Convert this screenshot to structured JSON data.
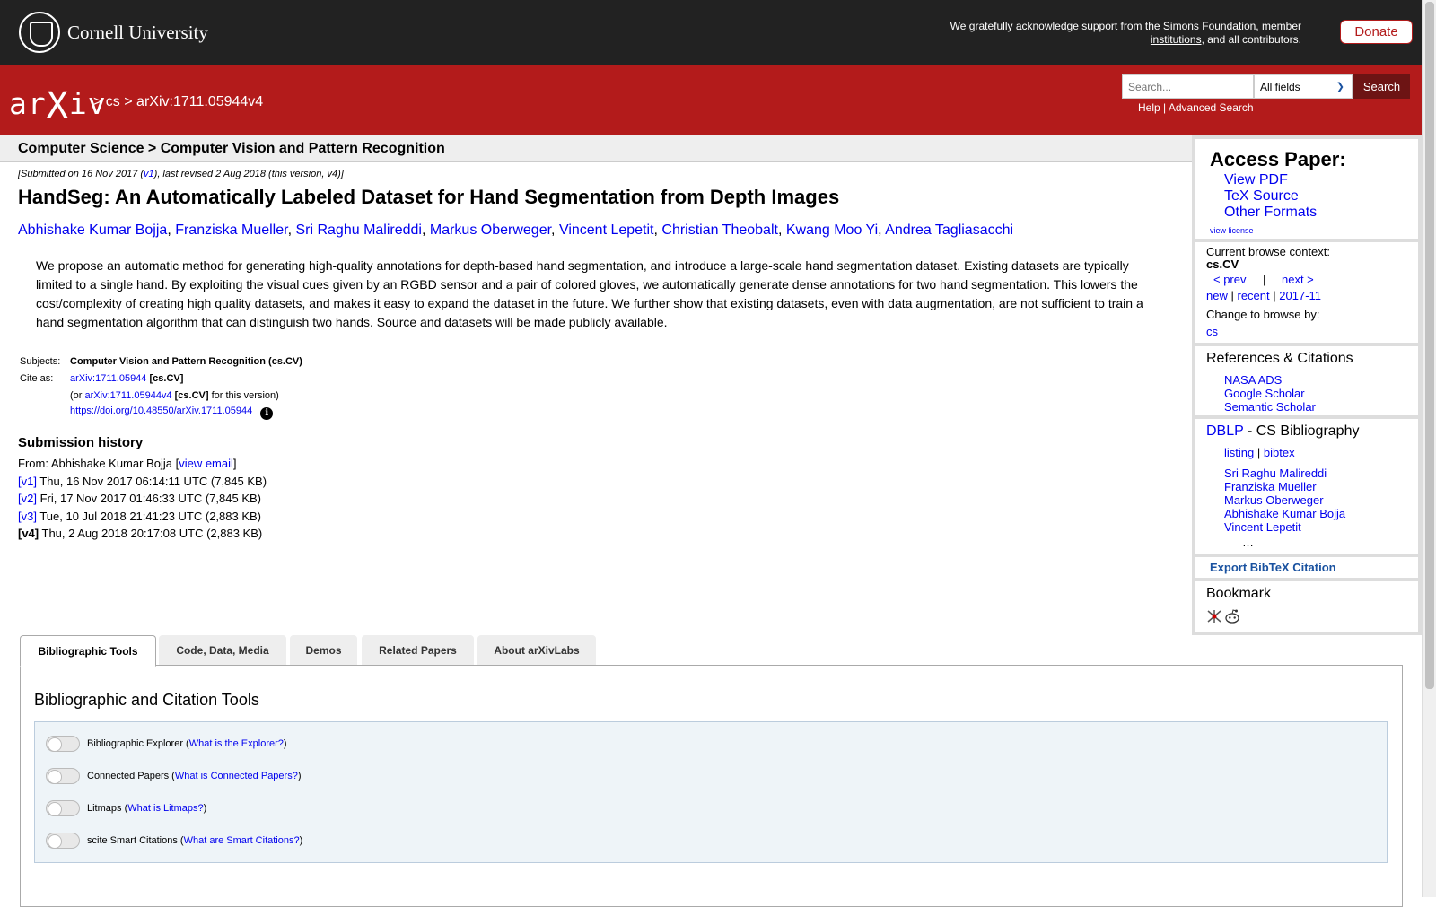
{
  "header": {
    "university": "Cornell University",
    "support_pre": "We gratefully acknowledge support from the Simons Foundation,",
    "support_link": "member institutions",
    "support_post": ", and all contributors.",
    "donate": "Donate"
  },
  "arxiv_bar": {
    "logo_a": "ar",
    "logo_x": "X",
    "logo_b": "iv",
    "crumb_sep1": ">",
    "crumb_cs": "cs",
    "crumb_sep2": ">",
    "crumb_id": "arXiv:1711.05944v4",
    "search_placeholder": "Search...",
    "search_field": "All fields",
    "search_button": "Search",
    "help": "Help",
    "help_sep": "|",
    "advanced": "Advanced Search"
  },
  "subheader": "Computer Science > Computer Vision and Pattern Recognition",
  "dateline": {
    "pre": "[Submitted on 16 Nov 2017 (",
    "v1": "v1",
    "post": "), last revised 2 Aug 2018 (this version, v4)]"
  },
  "title": "HandSeg: An Automatically Labeled Dataset for Hand Segmentation from Depth Images",
  "authors": [
    "Abhishake Kumar Bojja",
    "Franziska Mueller",
    "Sri Raghu Malireddi",
    "Markus Oberweger",
    "Vincent Lepetit",
    "Christian Theobalt",
    "Kwang Moo Yi",
    "Andrea Tagliasacchi"
  ],
  "abstract": "We propose an automatic method for generating high-quality annotations for depth-based hand segmentation, and introduce a large-scale hand segmentation dataset. Existing datasets are typically limited to a single hand. By exploiting the visual cues given by an RGBD sensor and a pair of colored gloves, we automatically generate dense annotations for two hand segmentation. This lowers the cost/complexity of creating high quality datasets, and makes it easy to expand the dataset in the future. We further show that existing datasets, even with data augmentation, are not sufficient to train a hand segmentation algorithm that can distinguish two hands. Source and datasets will be made publicly available.",
  "meta": {
    "subjects_label": "Subjects:",
    "subjects_value": "Computer Vision and Pattern Recognition (cs.CV)",
    "cite_label": "Cite as:",
    "cite_id": "arXiv:1711.05944",
    "cite_cat": "[cs.CV]",
    "or_pre": "(or",
    "or_id": "arXiv:1711.05944v4",
    "or_cat": "[cs.CV]",
    "or_post": "for this version)",
    "doi": "https://doi.org/10.48550/arXiv.1711.05944",
    "info_glyph": "i"
  },
  "history": {
    "title": "Submission history",
    "from_pre": "From: Abhishake Kumar Bojja [",
    "from_link": "view email",
    "from_post": "]",
    "versions": [
      {
        "tag": "[v1]",
        "text": " Thu, 16 Nov 2017 06:14:11 UTC (7,845 KB)"
      },
      {
        "tag": "[v2]",
        "text": " Fri, 17 Nov 2017 01:46:33 UTC (7,845 KB)"
      },
      {
        "tag": "[v3]",
        "text": " Tue, 10 Jul 2018 21:41:23 UTC (2,883 KB)"
      },
      {
        "tag": "[v4]",
        "text": " Thu, 2 Aug 2018 20:17:08 UTC (2,883 KB)"
      }
    ]
  },
  "sidebar": {
    "access_title": "Access Paper:",
    "view_pdf": "View PDF",
    "tex_source": "TeX Source",
    "other_formats": "Other Formats",
    "view_license": "view license",
    "context_label": "Current browse context:",
    "context_value": "cs.CV",
    "prev": "< prev",
    "nav_sep": "|",
    "next": "next >",
    "new": "new",
    "recent": "recent",
    "month": "2017-11",
    "sep": "|",
    "change_label": "Change to browse by:",
    "change_cs": "cs",
    "refs_title": "References & Citations",
    "nasa": "NASA ADS",
    "google": "Google Scholar",
    "semantic": "Semantic Scholar",
    "dblp": "DBLP",
    "dblp_post": " - CS Bibliography",
    "listing": "listing",
    "bibtex": "bibtex",
    "dblp_authors": [
      "Sri Raghu Malireddi",
      "Franziska Mueller",
      "Markus Oberweger",
      "Abhishake Kumar Bojja",
      "Vincent Lepetit"
    ],
    "ellipsis": "…",
    "export": "Export BibTeX Citation",
    "bookmark": "Bookmark"
  },
  "tabs": [
    "Bibliographic Tools",
    "Code, Data, Media",
    "Demos",
    "Related Papers",
    "About arXivLabs"
  ],
  "tools": {
    "title": "Bibliographic and Citation Tools",
    "items": [
      {
        "label": "Bibliographic Explorer",
        "link": "What is the Explorer?"
      },
      {
        "label": "Connected Papers",
        "link": "What is Connected Papers?"
      },
      {
        "label": "Litmaps",
        "link": "What is Litmaps?"
      },
      {
        "label": "scite Smart Citations",
        "link": "What are Smart Citations?"
      }
    ]
  },
  "colors": {
    "arxiv_red": "#b31b1b",
    "top_bar": "#222222",
    "link_blue": "#0000ee"
  }
}
